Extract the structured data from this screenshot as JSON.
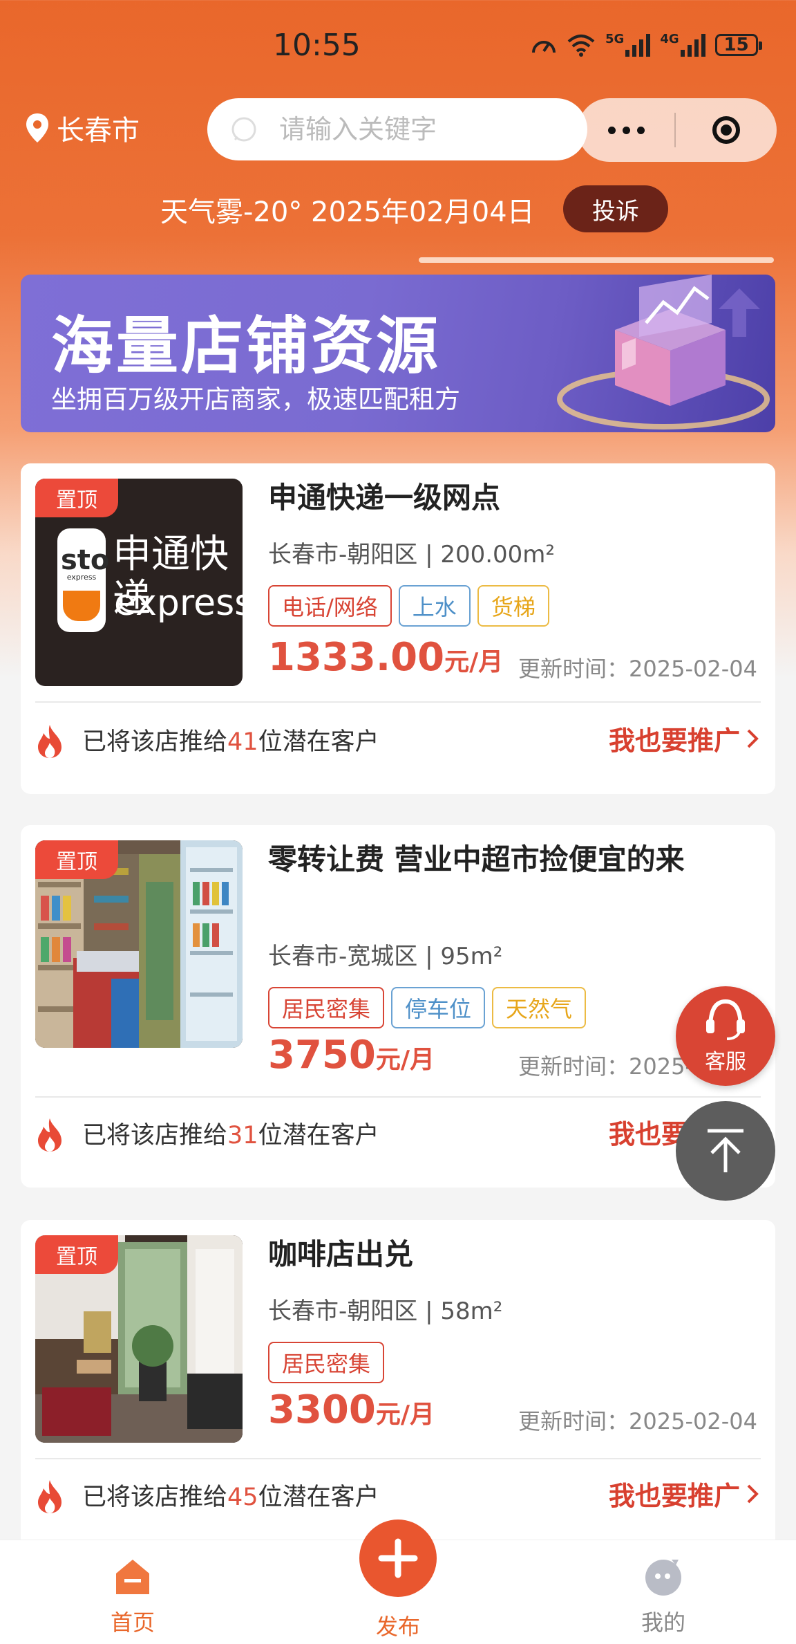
{
  "status_bar": {
    "time": "10:55",
    "net1": "5G",
    "net2": "4G",
    "battery": "15"
  },
  "header": {
    "city": "长春市",
    "search_placeholder": "请输入关键字",
    "weather": "天气雾-20° 2025年02月04日",
    "complain_label": "投诉"
  },
  "banner": {
    "title": "海量店铺资源",
    "subtitle": "坐拥百万级开店商家，极速匹配租方"
  },
  "listings": [
    {
      "pin_label": "置顶",
      "thumb_brand": "sto",
      "thumb_brand_sub": "express",
      "thumb_title_cn": "申通快递",
      "thumb_title_en": "express",
      "title": "申通快递一级网点",
      "location": "长春市-朝阳区 | 200.00m²",
      "tags": [
        "电话/网络",
        "上水",
        "货梯"
      ],
      "price": "1333.00",
      "price_unit": "元/月",
      "updated": "更新时间：2025-02-04",
      "footer_prefix": "已将该店推给",
      "footer_count": "41",
      "footer_suffix": "位潜在客户",
      "promote_label": "我也要推广"
    },
    {
      "pin_label": "置顶",
      "title": "零转让费 营业中超市捡便宜的来",
      "location": "长春市-宽城区 | 95m²",
      "tags": [
        "居民密集",
        "停车位",
        "天然气"
      ],
      "price": "3750",
      "price_unit": "元/月",
      "updated": "更新时间：2025-02-04",
      "footer_prefix": "已将该店推给",
      "footer_count": "31",
      "footer_suffix": "位潜在客户",
      "promote_label": "我也要推广"
    },
    {
      "pin_label": "置顶",
      "title": "咖啡店出兑",
      "location": "长春市-朝阳区 | 58m²",
      "tags": [
        "居民密集"
      ],
      "price": "3300",
      "price_unit": "元/月",
      "updated": "更新时间：2025-02-04",
      "footer_prefix": "已将该店推给",
      "footer_count": "45",
      "footer_suffix": "位潜在客户",
      "promote_label": "我也要推广"
    }
  ],
  "floating": {
    "service_label": "客服"
  },
  "tabbar": {
    "home": "首页",
    "publish": "发布",
    "mine": "我的"
  },
  "colors": {
    "primary": "#e9672b",
    "accent_red": "#e0523f",
    "tag_blue": "#4e90c8",
    "tag_yellow": "#e7a61a"
  }
}
